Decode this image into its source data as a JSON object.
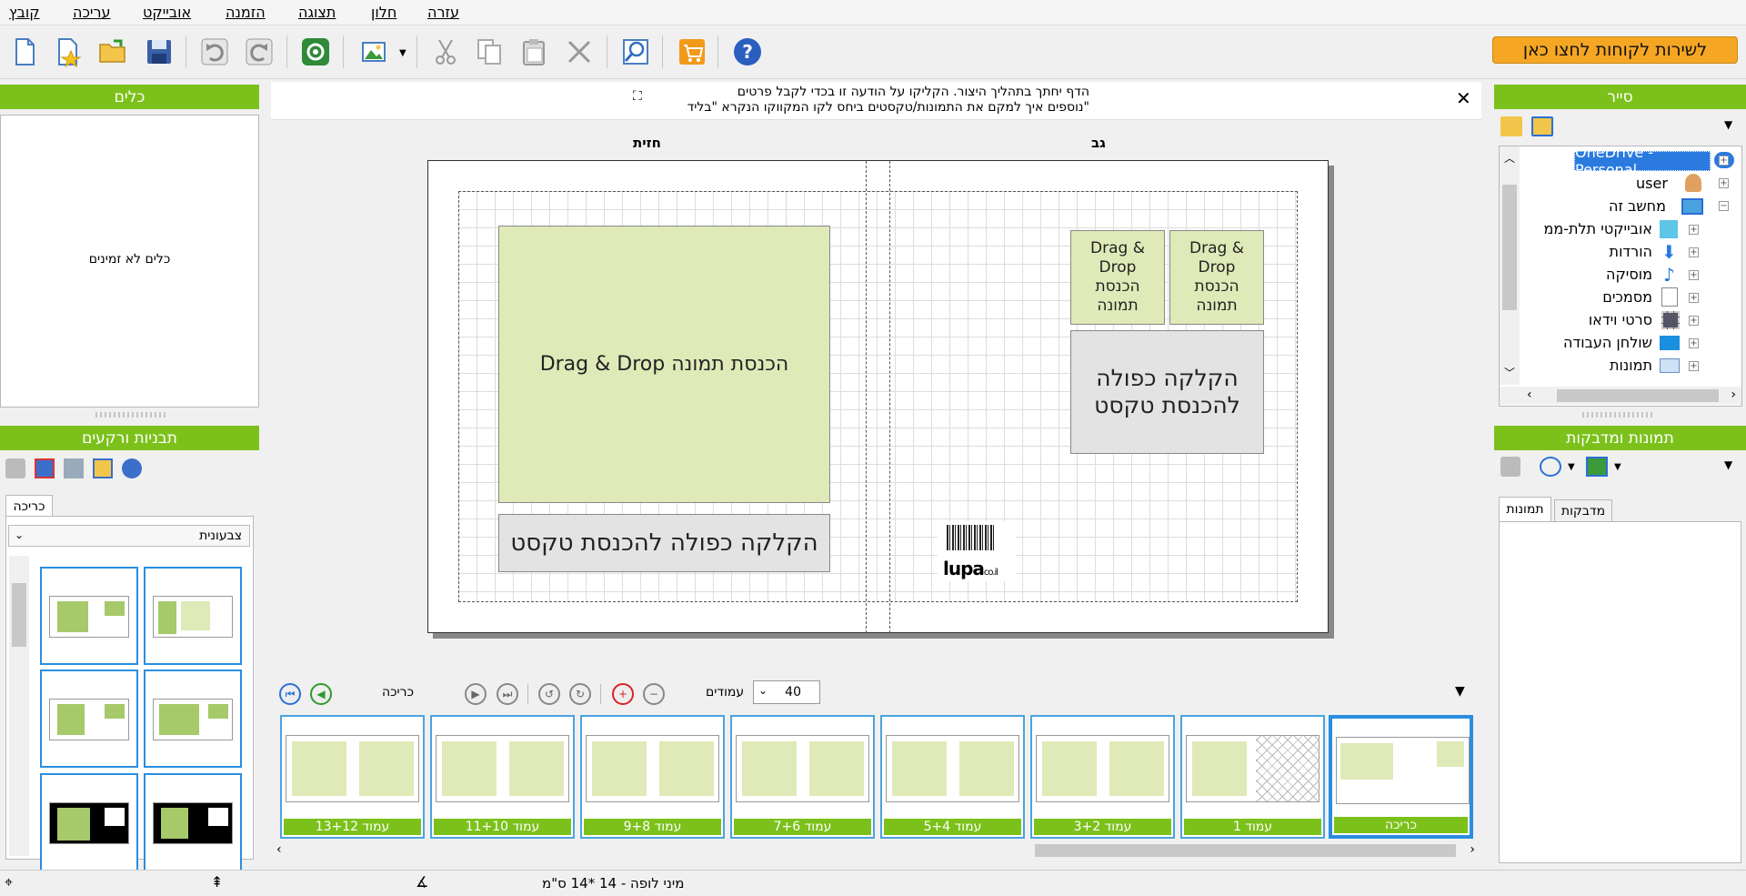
{
  "menu": [
    "קובץ",
    "עריכה",
    "אובייקט",
    "הזמנה",
    "תצוגה",
    "חלון",
    "עזרה"
  ],
  "toolbar": {
    "support_label": "לשירות לקוחות לחצו כאן",
    "icons": [
      "new-document-icon",
      "new-star-icon",
      "open-folder-icon",
      "save-icon",
      "undo-icon",
      "redo-icon",
      "sync-icon",
      "image-icon",
      "cut-icon",
      "copy-icon",
      "paste-icon",
      "delete-icon",
      "zoom-icon",
      "cart-icon",
      "help-icon"
    ]
  },
  "left_panel": {
    "tools_title": "כלים",
    "tools_empty": "כלים לא זמינים",
    "templates_title": "תבניות ורקעים",
    "templates_tab": "כריכה",
    "dropdown_value": "צבעונית"
  },
  "notice": {
    "line1": "הדף יחתך בתהליך היצור. הקליקו על הודעה זו בכדי לקבל פרטים",
    "line2": "נוספים איך למקם את התמונות/טקסטים ביחס לקו המקווקו הנקרא \"בליד\""
  },
  "canvas": {
    "label_front": "חזית",
    "label_back": "גב",
    "big_drop": "Drag & Drop הכנסת תמונה",
    "big_text": "הקלקה כפולה להכנסת טקסט",
    "small_drop_line1": "Drag &",
    "small_drop_line2": "Drop",
    "small_drop_line3": "הכנסת",
    "small_drop_line4": "תמונה",
    "back_text_line1": "הקלקה כפולה",
    "back_text_line2": "להכנסת טקסט",
    "logo_text": "lupa",
    "logo_suffix": "co.il"
  },
  "pages_bar": {
    "cover_label": "כריכה",
    "pages_label": "עמודים",
    "pages_count": "40"
  },
  "thumbnails": [
    "13+12 עמוד",
    "11+10 עמוד",
    "9+8 עמוד",
    "7+6 עמוד",
    "5+4 עמוד",
    "3+2 עמוד",
    "1 עמוד",
    "כריכה"
  ],
  "right_panel": {
    "explorer_title": "סייר",
    "tree": [
      "OneDrive - Personal",
      "user",
      "מחשב זה",
      "אובייקטי תלת-ממ",
      "הורדות",
      "מוסיקה",
      "מסמכים",
      "סרטי וידאו",
      "שולחן העבודה",
      "תמונות"
    ],
    "images_title": "תמונות ומדבקות",
    "tab_images": "תמונות",
    "tab_stickers": "מדבקות"
  },
  "status": {
    "product": "מיני לופה - 14 *14 ס\"מ"
  },
  "colors": {
    "accent_green": "#7cc11b",
    "support_orange": "#f5a623",
    "drop_green": "#dfeab8",
    "selection_blue": "#2a8ee0"
  }
}
